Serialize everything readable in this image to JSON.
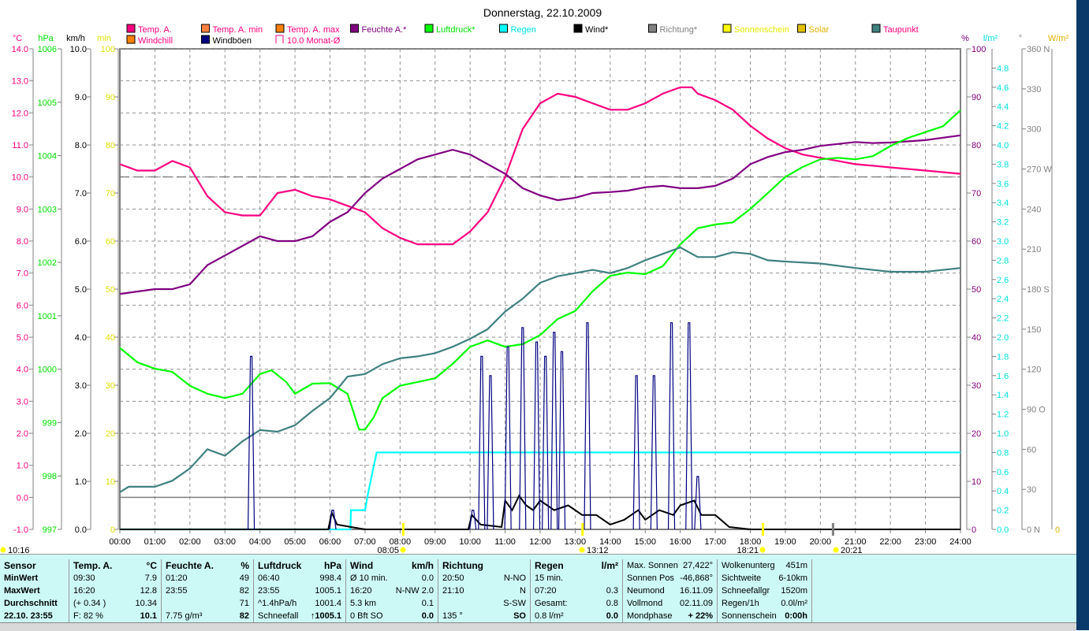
{
  "title": "Donnerstag, 22.10.2009",
  "axes": {
    "temp": {
      "unit": "°C",
      "min": -1,
      "max": 14,
      "step": 1,
      "color": "#ff0080"
    },
    "pressure": {
      "unit": "hPa",
      "min": 997,
      "max": 1006,
      "step": 1,
      "color": "#00e000"
    },
    "wind": {
      "unit": "km/h",
      "min": 0,
      "max": 10,
      "step": 1,
      "color": "#000000"
    },
    "minutes": {
      "unit": "min",
      "min": 0,
      "max": 100,
      "step": 10,
      "color": "#e0e000"
    },
    "humidity": {
      "unit": "%",
      "min": 0,
      "max": 100,
      "step": 10,
      "color": "#800080"
    },
    "rain": {
      "unit": "l/m²",
      "min": 0,
      "max": 4.8,
      "step": 0.2,
      "color": "#00e0e0"
    },
    "direction": {
      "unit": "°",
      "min": 0,
      "max": 360,
      "step": 30,
      "labels": {
        "0": "0 N",
        "90": "90 O",
        "180": "180 S",
        "270": "270 W",
        "360": "360 N"
      },
      "color": "#808080"
    },
    "solar": {
      "unit": "W/m²",
      "min": 0,
      "color": "#e0b000"
    }
  },
  "legend": [
    {
      "label": "Temp. A.",
      "swatch": "#ff0080",
      "text": "#ff0080",
      "row": 0,
      "col": 0
    },
    {
      "label": "Temp. A. min",
      "swatch": "#ff8040",
      "text": "#ff0080",
      "row": 0,
      "col": 1
    },
    {
      "label": "Temp. A. max",
      "swatch": "#ff8000",
      "text": "#ff0080",
      "row": 0,
      "col": 2
    },
    {
      "label": "Feuchte A.*",
      "swatch": "#800080",
      "text": "#800080",
      "row": 0,
      "col": 3
    },
    {
      "label": "Luftdruck*",
      "swatch": "#00ff00",
      "text": "#00e000",
      "row": 0,
      "col": 4
    },
    {
      "label": "Regen",
      "swatch": "#00ffff",
      "text": "#00e0e0",
      "row": 0,
      "col": 5
    },
    {
      "label": "Wind*",
      "swatch": "#000000",
      "text": "#000000",
      "row": 0,
      "col": 6
    },
    {
      "label": "Richtung*",
      "swatch": "#808080",
      "text": "#808080",
      "row": 0,
      "col": 7
    },
    {
      "label": "Sonnenschein",
      "swatch": "#ffff00",
      "text": "#e8e800",
      "row": 0,
      "col": 8
    },
    {
      "label": "Solar",
      "swatch": "#e0c000",
      "text": "#e0b000",
      "row": 0,
      "col": 9
    },
    {
      "label": "Taupunkt",
      "swatch": "#408080",
      "text": "#ff0080",
      "row": 0,
      "col": 10
    },
    {
      "label": "Windchill",
      "swatch": "#ff8000",
      "text": "#ff0080",
      "row": 1,
      "col": 0
    },
    {
      "label": "Windböen",
      "swatch": "#000080",
      "text": "#000000",
      "row": 1,
      "col": 1
    },
    {
      "label": "10.0 Monat-Ø",
      "swatch": "none",
      "text": "#ff0080",
      "row": 1,
      "col": 2
    }
  ],
  "chart_data": {
    "type": "line",
    "title": "Donnerstag, 22.10.2009",
    "xlabel": "",
    "x_ticks": [
      "00:00",
      "01:00",
      "02:00",
      "03:00",
      "04:00",
      "05:00",
      "06:00",
      "07:00",
      "08:00",
      "09:00",
      "10:00",
      "11:00",
      "12:00",
      "13:00",
      "14:00",
      "15:00",
      "16:00",
      "17:00",
      "18:00",
      "19:00",
      "20:00",
      "21:00",
      "22:00",
      "23:00",
      "24:00"
    ],
    "xlim": [
      0,
      24
    ],
    "grid": true,
    "reference_lines": [
      {
        "axis": "temp",
        "value": 0,
        "style": "solid",
        "color": "#808080"
      },
      {
        "axis": "temp",
        "value": 10.0,
        "style": "dashed",
        "color": "#606060",
        "label": "10.0 Monat-Ø"
      }
    ],
    "series": [
      {
        "name": "Temp. A.",
        "axis": "temp",
        "color": "#ff0080",
        "x": [
          0,
          0.5,
          1,
          1.5,
          2,
          2.5,
          3,
          3.5,
          4,
          4.5,
          5,
          5.5,
          6,
          6.5,
          7,
          7.5,
          8,
          8.5,
          9,
          9.5,
          10,
          10.5,
          11,
          11.5,
          12,
          12.5,
          13,
          13.5,
          14,
          14.5,
          15,
          15.5,
          16,
          16.33,
          16.5,
          17,
          17.5,
          18,
          18.5,
          19,
          19.5,
          20,
          20.5,
          21,
          21.5,
          22,
          23,
          24
        ],
        "y": [
          10.4,
          10.2,
          10.2,
          10.5,
          10.3,
          9.4,
          8.9,
          8.8,
          8.8,
          9.5,
          9.6,
          9.4,
          9.3,
          9.1,
          8.9,
          8.4,
          8.1,
          7.9,
          7.9,
          7.9,
          8.3,
          8.9,
          10.0,
          11.5,
          12.3,
          12.6,
          12.5,
          12.3,
          12.1,
          12.1,
          12.3,
          12.6,
          12.8,
          12.8,
          12.6,
          12.4,
          12.1,
          11.6,
          11.2,
          10.9,
          10.7,
          10.6,
          10.5,
          10.4,
          10.35,
          10.3,
          10.2,
          10.1
        ]
      },
      {
        "name": "Feuchte A.",
        "axis": "humidity",
        "color": "#800080",
        "x": [
          0,
          1,
          1.5,
          2,
          2.5,
          3,
          3.5,
          4,
          4.5,
          5,
          5.5,
          6,
          6.5,
          7,
          7.5,
          8,
          8.5,
          9,
          9.5,
          10,
          10.5,
          11,
          11.5,
          12,
          12.5,
          13,
          13.5,
          14,
          14.5,
          15,
          15.5,
          16,
          16.5,
          17,
          17.5,
          18,
          18.5,
          19,
          19.5,
          20,
          21,
          21.5,
          22,
          23,
          24
        ],
        "y": [
          49,
          50,
          50,
          51,
          55,
          57,
          59,
          61,
          60,
          60,
          61,
          64,
          66,
          70,
          73,
          75,
          77,
          78,
          79,
          78,
          76,
          74,
          71,
          69.5,
          68.5,
          69,
          70,
          70.2,
          70.5,
          71.2,
          71.5,
          71,
          71,
          71.5,
          73,
          76,
          77.5,
          78.5,
          79,
          79.8,
          80.6,
          80.4,
          80.5,
          81,
          82
        ]
      },
      {
        "name": "Luftdruck",
        "axis": "pressure",
        "color": "#00ff00",
        "x": [
          0,
          0.5,
          1,
          1.5,
          2,
          2.5,
          3,
          3.5,
          4,
          4.33,
          4.75,
          5,
          5.5,
          6,
          6.5,
          6.83,
          7,
          7.25,
          7.5,
          8,
          8.5,
          9,
          9.5,
          10,
          10.5,
          11,
          11.5,
          12,
          12.5,
          13,
          13.5,
          14,
          14.5,
          15,
          15.5,
          16,
          16.5,
          17,
          17.5,
          18,
          18.5,
          19,
          19.5,
          20,
          20.5,
          21,
          21.5,
          22,
          22.5,
          23,
          23.5,
          24
        ],
        "y": [
          1000.4,
          1000.13,
          1000.01,
          999.95,
          999.69,
          999.54,
          999.46,
          999.54,
          999.91,
          999.98,
          999.76,
          999.54,
          999.73,
          999.74,
          999.54,
          998.87,
          998.87,
          999.1,
          999.46,
          999.69,
          999.76,
          999.83,
          1000.1,
          1000.42,
          1000.54,
          1000.42,
          1000.47,
          1000.64,
          1000.94,
          1001.09,
          1001.46,
          1001.75,
          1001.81,
          1001.78,
          1001.93,
          1002.34,
          1002.64,
          1002.71,
          1002.75,
          1003.0,
          1003.3,
          1003.6,
          1003.79,
          1003.93,
          1003.96,
          1003.93,
          1003.99,
          1004.18,
          1004.33,
          1004.44,
          1004.55,
          1004.85
        ]
      },
      {
        "name": "Taupunkt",
        "axis": "temp",
        "color": "#408080",
        "x": [
          0,
          0.25,
          1,
          1.5,
          2,
          2.5,
          3,
          3.5,
          4,
          4.5,
          5,
          5.5,
          6,
          6.5,
          7,
          7.5,
          8,
          8.5,
          9,
          9.5,
          10,
          10.5,
          11,
          11.5,
          12,
          12.5,
          13,
          13.5,
          14,
          14.5,
          15,
          15.5,
          16,
          16.5,
          17,
          17.5,
          18,
          18.5,
          19,
          20,
          21,
          22,
          23,
          24
        ],
        "y": [
          0.16,
          0.33,
          0.33,
          0.52,
          0.9,
          1.5,
          1.3,
          1.75,
          2.1,
          2.05,
          2.25,
          2.7,
          3.1,
          3.77,
          3.85,
          4.16,
          4.34,
          4.4,
          4.5,
          4.7,
          4.95,
          5.25,
          5.8,
          6.2,
          6.7,
          6.9,
          7.0,
          7.1,
          7.0,
          7.16,
          7.4,
          7.6,
          7.8,
          7.5,
          7.5,
          7.65,
          7.6,
          7.4,
          7.36,
          7.3,
          7.16,
          7.04,
          7.04,
          7.16
        ]
      },
      {
        "name": "Regen",
        "axis": "rain",
        "color": "#00ffff",
        "x": [
          0,
          6.58,
          6.6,
          7.0,
          7.1,
          7.33,
          7.35,
          24
        ],
        "y": [
          0,
          0,
          0.2,
          0.2,
          0.4,
          0.8,
          0.8,
          0.8
        ]
      },
      {
        "name": "Wind",
        "axis": "wind",
        "color": "#000000",
        "x": [
          0,
          5.95,
          6.05,
          6.2,
          6.6,
          7.0,
          9.95,
          10.05,
          10.3,
          10.9,
          11.0,
          11.2,
          11.4,
          11.6,
          11.8,
          12.0,
          12.4,
          12.8,
          13.2,
          13.6,
          14.0,
          14.4,
          14.8,
          15.0,
          15.4,
          15.8,
          16.0,
          16.4,
          16.6,
          17.0,
          17.4,
          18.0,
          24
        ],
        "y": [
          0,
          0,
          0.35,
          0.1,
          0.05,
          0,
          0,
          0.3,
          0.1,
          0.05,
          0.6,
          0.4,
          0.7,
          0.5,
          0.4,
          0.6,
          0.4,
          0.5,
          0.3,
          0.3,
          0.1,
          0.2,
          0.4,
          0.2,
          0.4,
          0.3,
          0.5,
          0.6,
          0.3,
          0.3,
          0.05,
          0,
          0
        ]
      },
      {
        "name": "Windböen",
        "axis": "wind",
        "color": "#000080",
        "type": "spikes",
        "x": [
          3.75,
          6.08,
          10.08,
          10.33,
          10.58,
          11.08,
          11.5,
          11.9,
          12.15,
          12.4,
          12.62,
          13.35,
          14.75,
          15.25,
          15.75,
          16.25,
          16.5
        ],
        "y": [
          3.6,
          0.4,
          0.4,
          3.6,
          3.2,
          3.8,
          4.2,
          3.9,
          3.6,
          4.1,
          3.7,
          4.3,
          3.2,
          3.2,
          4.3,
          4.3,
          1.1
        ]
      }
    ]
  },
  "time_markers": {
    "left": "10:16",
    "sunrise": "08:05",
    "noon": "13:12",
    "sunset": "18:21",
    "moon": "20:21"
  },
  "table": [
    {
      "rows": [
        [
          "Sensor",
          ""
        ],
        [
          "MinWert",
          ""
        ],
        [
          "MaxWert",
          ""
        ],
        [
          "Durchschnitt",
          ""
        ],
        [
          "22.10. 23:55",
          ""
        ]
      ],
      "bold_left": true
    },
    {
      "rows": [
        [
          "Temp. A.",
          "°C"
        ],
        [
          "09:30",
          "7.9"
        ],
        [
          "16:20",
          "12.8"
        ],
        [
          "(+ 0.34 )",
          "10.34"
        ],
        [
          "F: 82 %",
          "10.1"
        ]
      ]
    },
    {
      "rows": [
        [
          "Feuchte A.",
          "%"
        ],
        [
          "01:20",
          "49"
        ],
        [
          "23:55",
          "82"
        ],
        [
          "",
          "71"
        ],
        [
          "7.75 g/m³",
          "82"
        ]
      ]
    },
    {
      "rows": [
        [
          "Luftdruck",
          "hPa"
        ],
        [
          "06:40",
          "998.4"
        ],
        [
          "23:55",
          "1005.1"
        ],
        [
          "^1.4hPa/h",
          "1001.4"
        ],
        [
          "Schneefall",
          "↑1005.1"
        ]
      ]
    },
    {
      "rows": [
        [
          "Wind",
          "km/h"
        ],
        [
          "Ø 10 min.",
          "0.0"
        ],
        [
          "16:20",
          "N-NW 2.0"
        ],
        [
          "5.3 km",
          "0.1"
        ],
        [
          "0 Bft SO",
          "0.0"
        ]
      ]
    },
    {
      "rows": [
        [
          "Richtung",
          ""
        ],
        [
          "20:50",
          "N-NO"
        ],
        [
          "21:10",
          "N"
        ],
        [
          "",
          "S-SW"
        ],
        [
          "135 °",
          "SO"
        ]
      ]
    },
    {
      "rows": [
        [
          "Regen",
          "l/m²"
        ],
        [
          "15 min.",
          ""
        ],
        [
          "07:20",
          "0.3"
        ],
        [
          "Gesamt:",
          "0.8"
        ],
        [
          "0.8 l/m²",
          "0.0"
        ]
      ]
    },
    {
      "rows": [
        [
          "Max. Sonnen",
          "27,422°"
        ],
        [
          "Sonnen Pos",
          "-46,868°"
        ],
        [
          "Neumond",
          "16.11.09"
        ],
        [
          "Vollmond",
          "02.11.09"
        ],
        [
          "Mondphase",
          "+ 22%"
        ]
      ],
      "plain_head": true
    },
    {
      "rows": [
        [
          "Wolkenunterg",
          "451m"
        ],
        [
          "Sichtweite",
          "6-10km"
        ],
        [
          "Schneefallgr",
          "1520m"
        ],
        [
          "Regen/1h",
          "0.0l/m²"
        ],
        [
          "Sonnenschein",
          "0:00h"
        ]
      ],
      "plain_head": true
    }
  ]
}
